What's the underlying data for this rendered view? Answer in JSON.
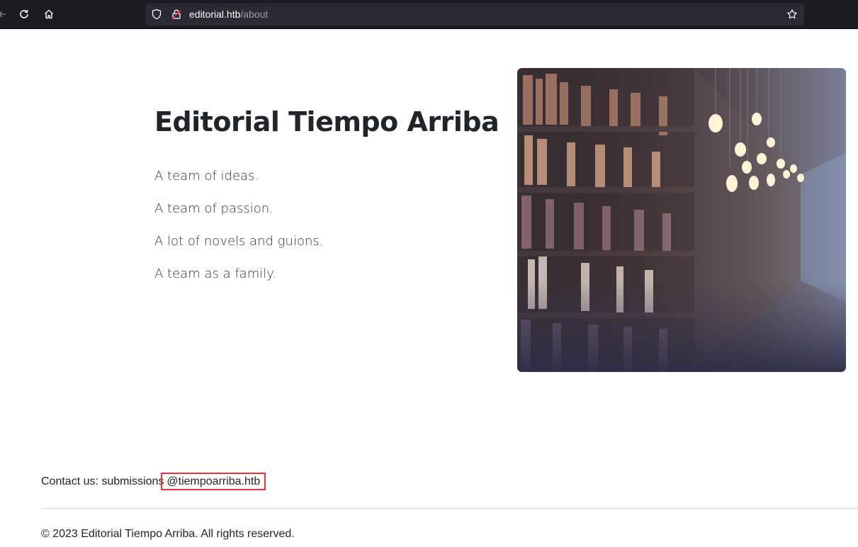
{
  "browser": {
    "url_host": "editorial.htb",
    "url_path": "/about",
    "icons": [
      "back-icon",
      "reload-icon",
      "home-icon",
      "shield-icon",
      "lock-icon",
      "star-icon"
    ]
  },
  "about": {
    "title": "Editorial Tiempo Arriba",
    "taglines": [
      "A team of ideas.",
      "A team of passion.",
      "A lot of novels and guions.",
      "A team as a family."
    ]
  },
  "footer": {
    "contact_prefix": "Contact us: submissions",
    "contact_domain": "@tiempoarriba.htb",
    "copyright": "© 2023 Editorial Tiempo Arriba. All rights reserved."
  },
  "colors": {
    "chrome_bg": "#1c1b22",
    "urlbar_bg": "#2b2a33",
    "highlight": "#e8333d"
  }
}
